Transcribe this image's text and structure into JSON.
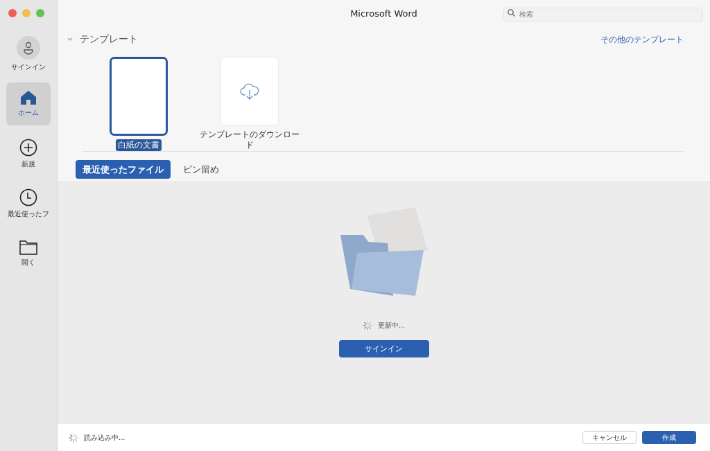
{
  "window": {
    "title": "Microsoft Word"
  },
  "search": {
    "placeholder": "検索"
  },
  "sidebar": {
    "items": [
      {
        "kind": "account",
        "label": "サインイン",
        "selected": false
      },
      {
        "kind": "home",
        "label": "ホーム",
        "selected": true
      },
      {
        "kind": "new",
        "label": "新規",
        "selected": false
      },
      {
        "kind": "recent",
        "label": "最近使ったフ",
        "selected": false
      },
      {
        "kind": "open",
        "label": "開く",
        "selected": false
      }
    ]
  },
  "templates": {
    "title": "テンプレート",
    "expanded": true,
    "more_link": "その他のテンプレート",
    "items": [
      {
        "kind": "blank",
        "label": "白紙の文書",
        "selected": true
      },
      {
        "kind": "download",
        "label": "テンプレートのダウンロード",
        "selected": false
      }
    ]
  },
  "tabs": [
    {
      "label": "最近使ったファイル",
      "selected": true
    },
    {
      "label": "ピン留め",
      "selected": false
    }
  ],
  "files": {
    "status": "更新中...",
    "button": "サインイン"
  },
  "footer": {
    "status": "読み込み中...",
    "buttons": [
      {
        "kind": "secondary",
        "label": "キャンセル"
      },
      {
        "kind": "primary",
        "label": "作成"
      }
    ]
  }
}
